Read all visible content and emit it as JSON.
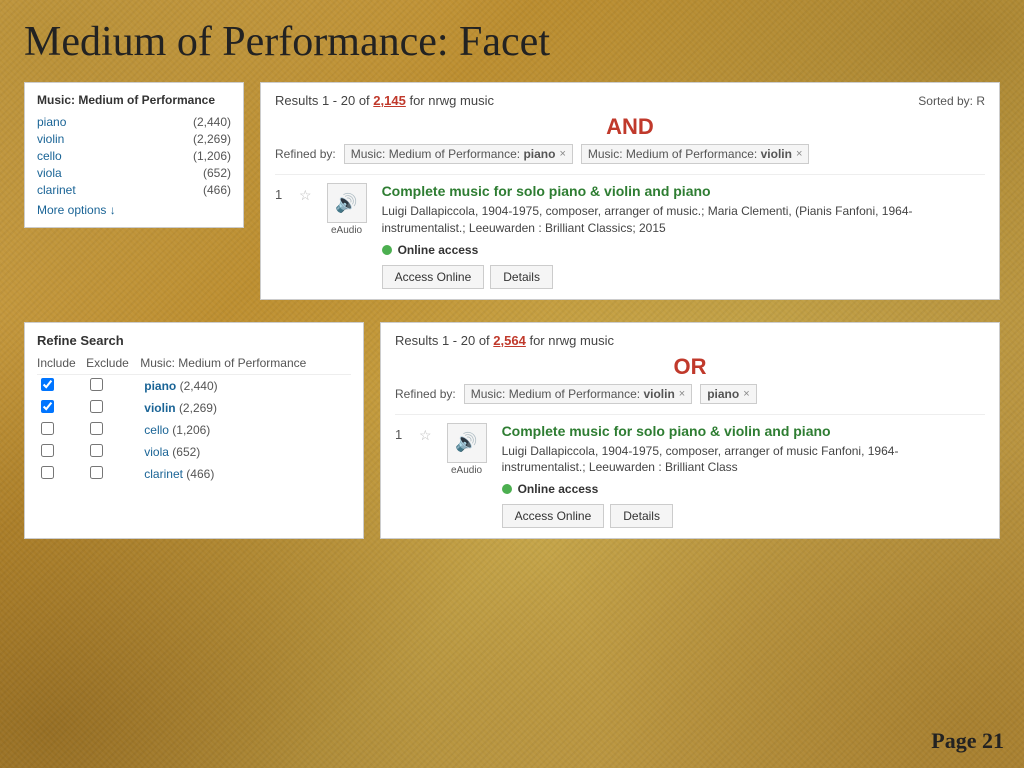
{
  "page": {
    "title": "Medium of Performance: Facet",
    "page_number": "Page 21"
  },
  "top_facet": {
    "title": "Music: Medium of Performance",
    "items": [
      {
        "name": "piano",
        "count": "(2,440)"
      },
      {
        "name": "violin",
        "count": "(2,269)"
      },
      {
        "name": "cello",
        "count": "(1,206)"
      },
      {
        "name": "viola",
        "count": "(652)"
      },
      {
        "name": "clarinet",
        "count": "(466)"
      }
    ],
    "more_options": "More options ↓"
  },
  "and_label": "AND",
  "or_label": "OR",
  "top_results": {
    "summary": "Results 1 - 20 of",
    "count": "2,145",
    "for_text": "for nrwg music",
    "sorted_by": "Sorted by: R",
    "refined_by_label": "Refined by:",
    "filters": [
      {
        "text": "Music: Medium of Performance: piano",
        "key": "piano"
      },
      {
        "text": "Music: Medium of Performance: violin",
        "key": "violin"
      }
    ],
    "result_number": "1",
    "result_title": "Complete music for solo piano & violin and piano",
    "result_meta": "Luigi Dallapiccola, 1904-1975, composer, arranger of music.; Maria Clementi, (Pianis Fanfoni, 1964- instrumentalist.; Leeuwarden : Brilliant Classics; 2015",
    "online_access": "Online access",
    "eaudio_label": "eAudio",
    "btn_access": "Access Online",
    "btn_details": "Details"
  },
  "refine_panel": {
    "title": "Refine Search",
    "col_include": "Include",
    "col_exclude": "Exclude",
    "col_facet": "Music: Medium of Performance",
    "items": [
      {
        "name": "piano",
        "count": "(2,440)",
        "include": true,
        "exclude": false
      },
      {
        "name": "violin",
        "count": "(2,269)",
        "include": true,
        "exclude": false
      },
      {
        "name": "cello",
        "count": "(1,206)",
        "include": false,
        "exclude": false
      },
      {
        "name": "viola",
        "count": "(652)",
        "include": false,
        "exclude": false
      },
      {
        "name": "clarinet",
        "count": "(466)",
        "include": false,
        "exclude": false
      }
    ]
  },
  "bottom_results": {
    "summary": "Results 1 - 20 of",
    "count": "2,564",
    "for_text": "for nrwg music",
    "refined_by_label": "Refined by:",
    "filters": [
      {
        "text": "Music: Medium of Performance: violin",
        "key": "violin"
      },
      {
        "text": "piano",
        "key": "piano"
      }
    ],
    "result_number": "1",
    "result_title": "Complete music for solo piano & violin and piano",
    "result_meta": "Luigi Dallapiccola, 1904-1975, composer, arranger of music Fanfoni, 1964- instrumentalist.; Leeuwarden : Brilliant Class",
    "online_access": "Online access",
    "eaudio_label": "eAudio",
    "btn_access": "Access Online",
    "btn_details": "Details"
  }
}
